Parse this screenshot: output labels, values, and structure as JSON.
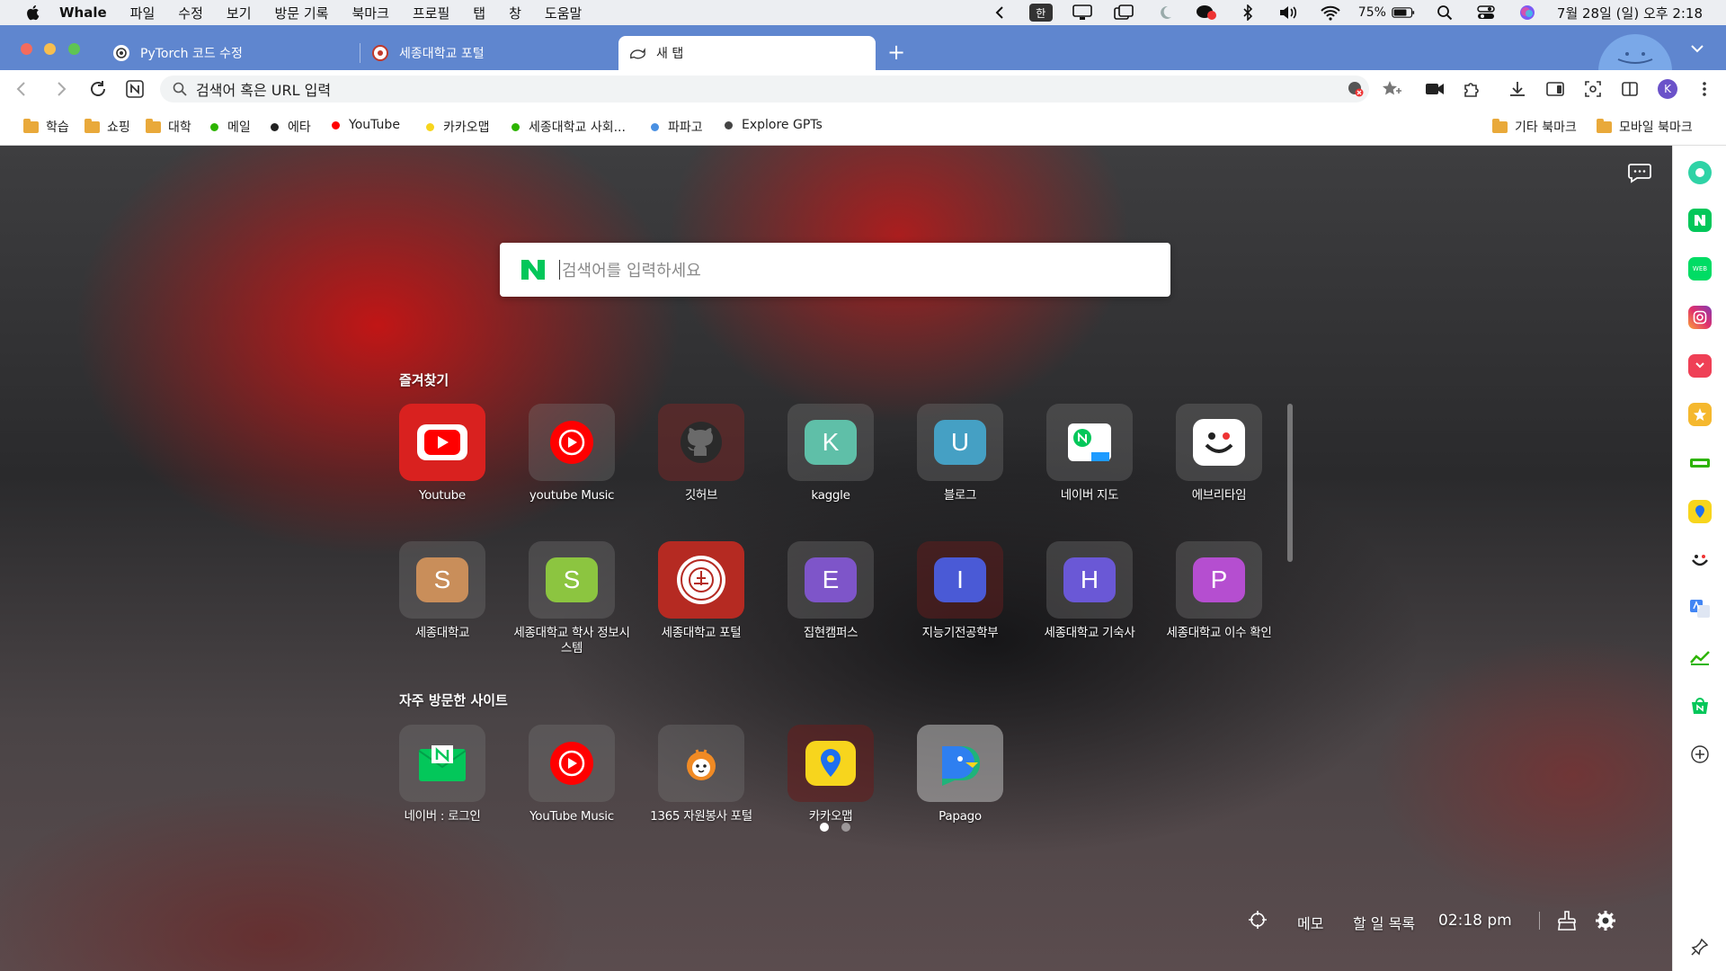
{
  "menubar": {
    "app_name": "Whale",
    "menus": [
      "파일",
      "수정",
      "보기",
      "방문 기록",
      "북마크",
      "프로필",
      "탭",
      "창",
      "도움말"
    ],
    "input_mode": "한",
    "battery": "75%",
    "clock": "7월 28일 (일) 오후 2:18"
  },
  "tabs": [
    {
      "title": "PyTorch 코드 수정",
      "icon": "openai-icon"
    },
    {
      "title": "세종대학교 포털",
      "icon": "sejong-icon"
    },
    {
      "title": "새 탭",
      "icon": "whale-icon",
      "active": true
    }
  ],
  "toolbar": {
    "omnibox_placeholder": "검색어 혹은 URL 입력",
    "profile_initial": "K"
  },
  "bookmarks": {
    "left": [
      {
        "label": "학습",
        "type": "folder"
      },
      {
        "label": "쇼핑",
        "type": "folder"
      },
      {
        "label": "대학",
        "type": "folder"
      },
      {
        "label": "메일",
        "type": "dot",
        "color": "#2db400"
      },
      {
        "label": "에타",
        "type": "dot",
        "color": "#222222"
      },
      {
        "label": "YouTube",
        "type": "dot",
        "color": "#ff0000"
      },
      {
        "label": "카카오맵",
        "type": "dot",
        "color": "#f7d51d"
      },
      {
        "label": "세종대학교 사회...",
        "type": "dot",
        "color": "#2db400"
      },
      {
        "label": "파파고",
        "type": "dot",
        "color": "#4a90e2"
      },
      {
        "label": "Explore GPTs",
        "type": "dot",
        "color": "#444444"
      }
    ],
    "right": [
      {
        "label": "기타 북마크",
        "type": "folder"
      },
      {
        "label": "모바일 북마크",
        "type": "folder"
      }
    ]
  },
  "search": {
    "placeholder": "검색어를 입력하세요"
  },
  "favorites": {
    "title": "즐겨찾기",
    "items": [
      {
        "label": "Youtube",
        "icon": "youtube-icon"
      },
      {
        "label": "youtube Music",
        "icon": "youtube-music-icon"
      },
      {
        "label": "깃허브",
        "icon": "github-icon"
      },
      {
        "label": "kaggle",
        "letter": "K",
        "color": "#5fbfa8"
      },
      {
        "label": "블로그",
        "letter": "U",
        "color": "#45a0c4"
      },
      {
        "label": "네이버 지도",
        "icon": "naver-map-icon"
      },
      {
        "label": "에브리타임",
        "icon": "everytime-icon"
      },
      {
        "label": "세종대학교",
        "letter": "S",
        "color": "#c98e5a"
      },
      {
        "label": "세종대학교 학사 정보시스템",
        "letter": "S",
        "color": "#8cc540"
      },
      {
        "label": "세종대학교 포털",
        "icon": "sejong-seal-icon"
      },
      {
        "label": "집현캠퍼스",
        "letter": "E",
        "color": "#7e55c9"
      },
      {
        "label": "지능기전공학부",
        "letter": "I",
        "color": "#4a5ad6"
      },
      {
        "label": "세종대학교 기숙사",
        "letter": "H",
        "color": "#6a58d6"
      },
      {
        "label": "세종대학교 이수 확인",
        "letter": "P",
        "color": "#b54ed0"
      }
    ]
  },
  "frequent": {
    "title": "자주 방문한 사이트",
    "items": [
      {
        "label": "네이버 : 로그인",
        "icon": "naver-mail-icon"
      },
      {
        "label": "YouTube Music",
        "icon": "youtube-music-icon"
      },
      {
        "label": "1365 자원봉사 포털",
        "icon": "volunteer-icon"
      },
      {
        "label": "카카오맵",
        "icon": "kakaomap-icon"
      },
      {
        "label": "Papago",
        "icon": "papago-icon"
      }
    ]
  },
  "bottom_bar": {
    "memo": "메모",
    "todo": "할 일 목록",
    "time": "02:18 pm"
  },
  "colors": {
    "tab_strip": "#5f86cf",
    "naver_green": "#03c75a",
    "youtube_red": "#ff0000"
  }
}
